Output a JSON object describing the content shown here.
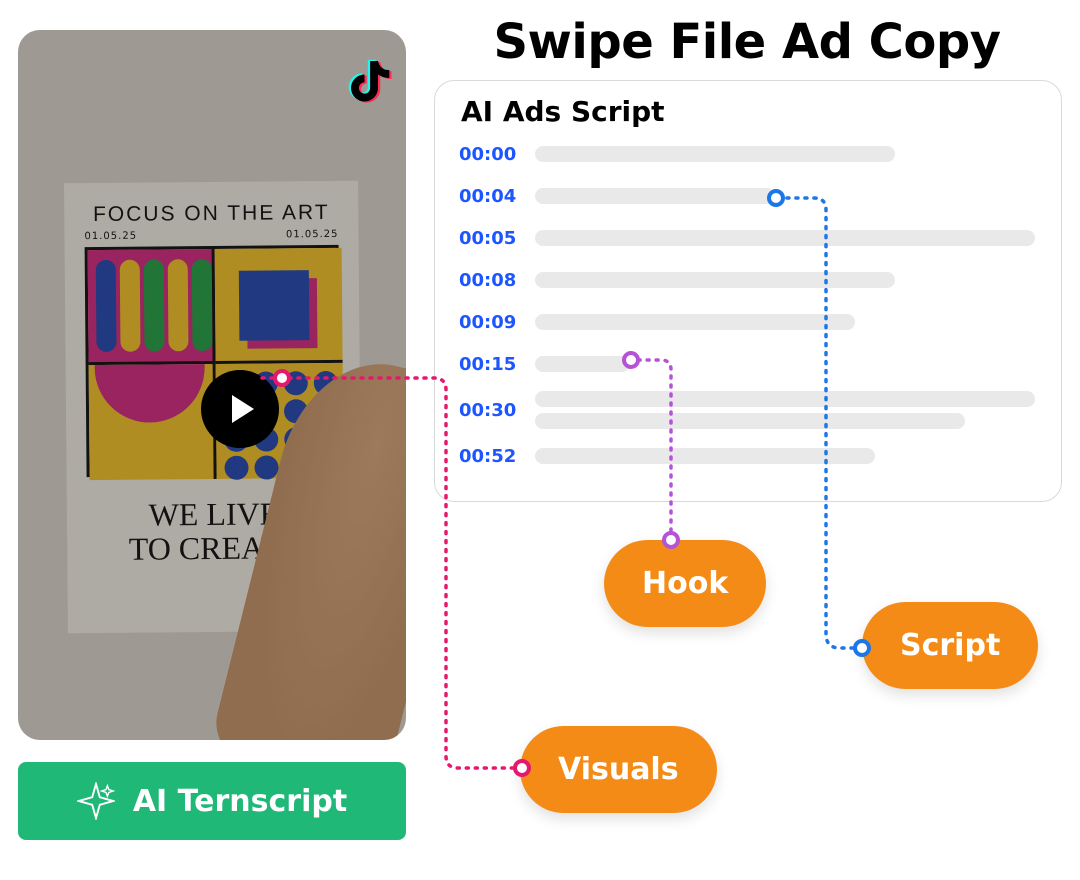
{
  "title": "Swipe File Ad Copy",
  "button_label": "AI Ternscript",
  "panel": {
    "title": "AI Ads Script",
    "rows": [
      {
        "time": "00:00",
        "bars": [
          360
        ]
      },
      {
        "time": "00:04",
        "bars": [
          240
        ]
      },
      {
        "time": "00:05",
        "bars": [
          500
        ]
      },
      {
        "time": "00:08",
        "bars": [
          360
        ]
      },
      {
        "time": "00:09",
        "bars": [
          320
        ]
      },
      {
        "time": "00:15",
        "bars": [
          95
        ]
      },
      {
        "time": "00:30",
        "bars": [
          500,
          430
        ]
      },
      {
        "time": "00:52",
        "bars": [
          340
        ]
      }
    ]
  },
  "pills": {
    "visuals": "Visuals",
    "hook": "Hook",
    "script": "Script"
  },
  "poster": {
    "title": "FOCUS ON THE ART",
    "date": "01.05.25",
    "subtitle_1": "WE LIVE",
    "subtitle_2": "TO CREATE"
  }
}
